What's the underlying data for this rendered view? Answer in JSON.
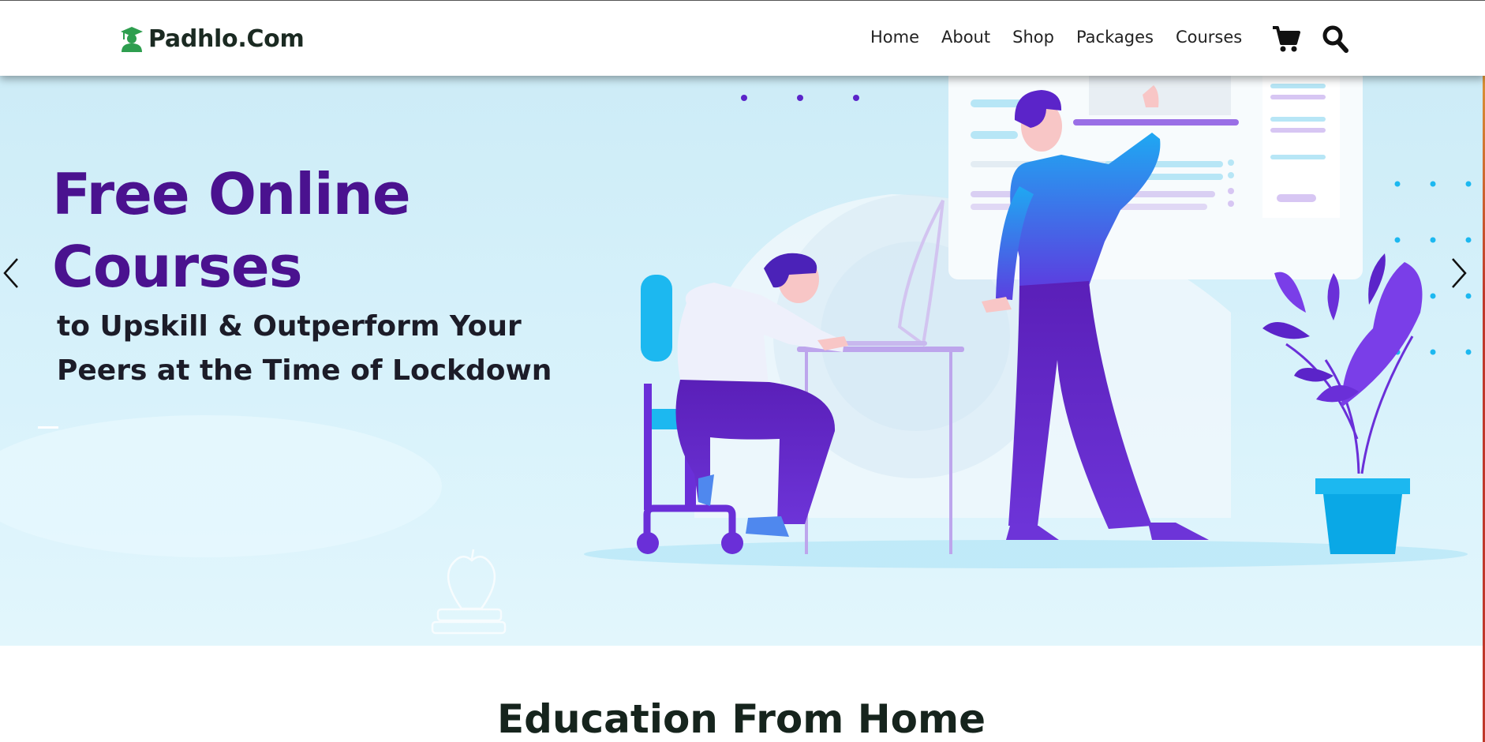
{
  "brand": {
    "name": "Padhlo.Com",
    "icon": "graduate-icon",
    "color": "#2e9e4f"
  },
  "nav": {
    "items": [
      {
        "label": "Home"
      },
      {
        "label": "About"
      },
      {
        "label": "Shop"
      },
      {
        "label": "Packages"
      },
      {
        "label": "Courses"
      }
    ],
    "cart_icon": "cart-icon",
    "search_icon": "search-icon"
  },
  "hero": {
    "title": "Free Online Courses",
    "subtitle": "to Upskill & Outperform Your Peers at the Time of Lockdown",
    "prev_icon": "chevron-left-icon",
    "next_icon": "chevron-right-icon",
    "colors": {
      "title": "#4a128f",
      "accent": "#6a2fd8",
      "cyan": "#1cb8f0"
    }
  },
  "section": {
    "heading": "Education From Home"
  }
}
